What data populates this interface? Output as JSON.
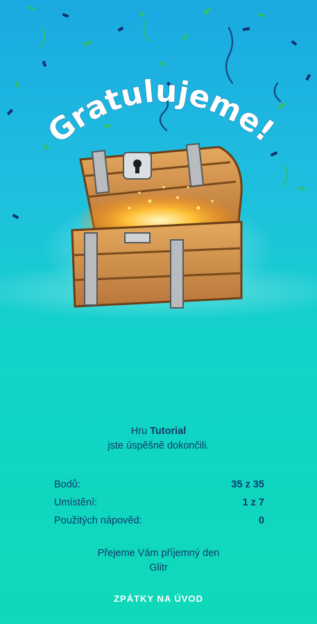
{
  "title": "Gratulujeme!",
  "result": {
    "game_prefix": "Hru",
    "game_name": "Tutorial",
    "completed_text": "jste úspěšně dokončili."
  },
  "stats": [
    {
      "label": "Bodů:",
      "value": "35 z 35"
    },
    {
      "label": "Umístění:",
      "value": "1 z 7"
    },
    {
      "label": "Použitých nápověd:",
      "value": "0"
    }
  ],
  "wish": {
    "line1": "Přejeme Vám příjemný den",
    "line2": "Glitr"
  },
  "back_button": "ZPÁTKY NA ÚVOD",
  "colors": {
    "text": "#133a6b",
    "bg_top": "#1aa9e0",
    "bg_bottom": "#0fd9b9",
    "confetti_green": "#38c27a",
    "confetti_navy": "#14306e",
    "chest_wood": "#d89a4d"
  }
}
